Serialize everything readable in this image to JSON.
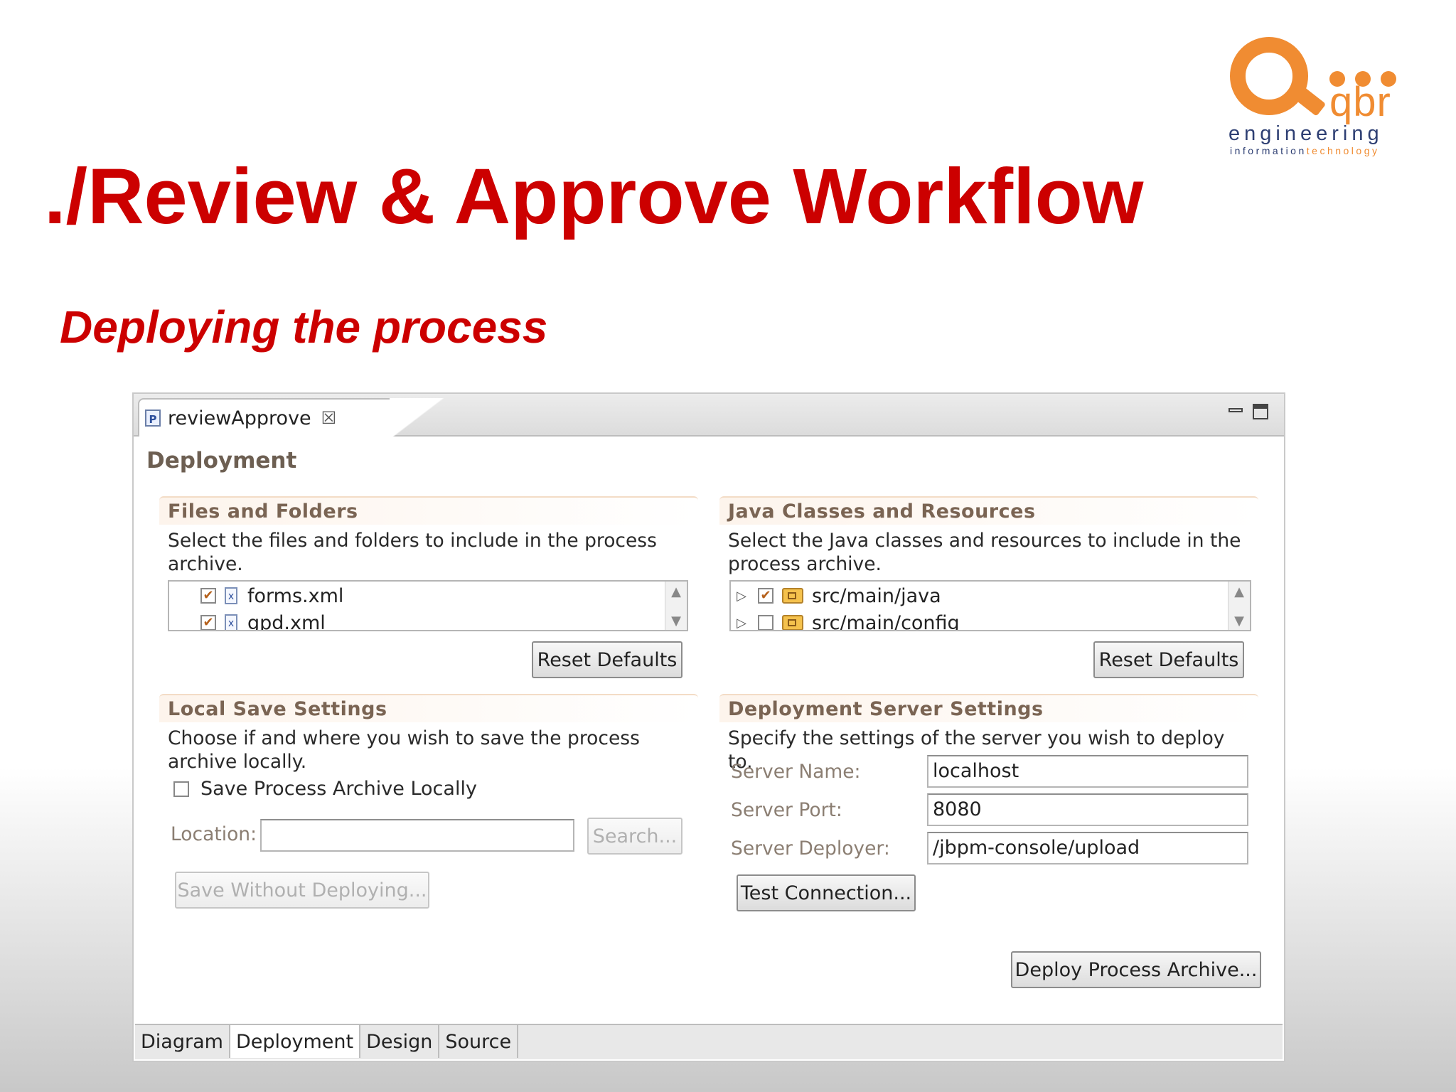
{
  "logo": {
    "mark": "Q",
    "brand": "qbr",
    "line1": "engineering",
    "line2a": "information",
    "line2b": "technology"
  },
  "slide": {
    "title": "./Review & Approve Workflow",
    "subtitle": "Deploying the process"
  },
  "editor": {
    "tab_label": "reviewApprove",
    "page_heading": "Deployment",
    "files_folders": {
      "header": "Files and Folders",
      "description": "Select the files and folders to include in the process archive.",
      "items": [
        {
          "label": "forms.xml",
          "checked": true
        },
        {
          "label": "gpd.xml",
          "checked": true
        }
      ],
      "reset_label": "Reset Defaults"
    },
    "java_classes": {
      "header": "Java Classes and Resources",
      "description": "Select the Java classes and resources to include in the process archive.",
      "items": [
        {
          "label": "src/main/java",
          "checked": true
        },
        {
          "label": "src/main/config",
          "checked": false
        }
      ],
      "reset_label": "Reset Defaults"
    },
    "local_save": {
      "header": "Local Save Settings",
      "description": "Choose if and where you wish to save the process archive locally.",
      "save_locally_label": "Save Process Archive Locally",
      "save_locally_checked": false,
      "location_label": "Location:",
      "location_value": "",
      "search_label": "Search...",
      "save_without_deploying_label": "Save Without Deploying..."
    },
    "server_settings": {
      "header": "Deployment Server Settings",
      "description": "Specify the settings of the server you wish to deploy to.",
      "server_name_label": "Server Name:",
      "server_name_value": "localhost",
      "server_port_label": "Server Port:",
      "server_port_value": "8080",
      "server_deployer_label": "Server Deployer:",
      "server_deployer_value": "/jbpm-console/upload",
      "test_connection_label": "Test Connection..."
    },
    "deploy_label": "Deploy Process Archive...",
    "bottom_tabs": [
      "Diagram",
      "Deployment",
      "Design",
      "Source"
    ],
    "active_bottom_tab": "Deployment"
  }
}
